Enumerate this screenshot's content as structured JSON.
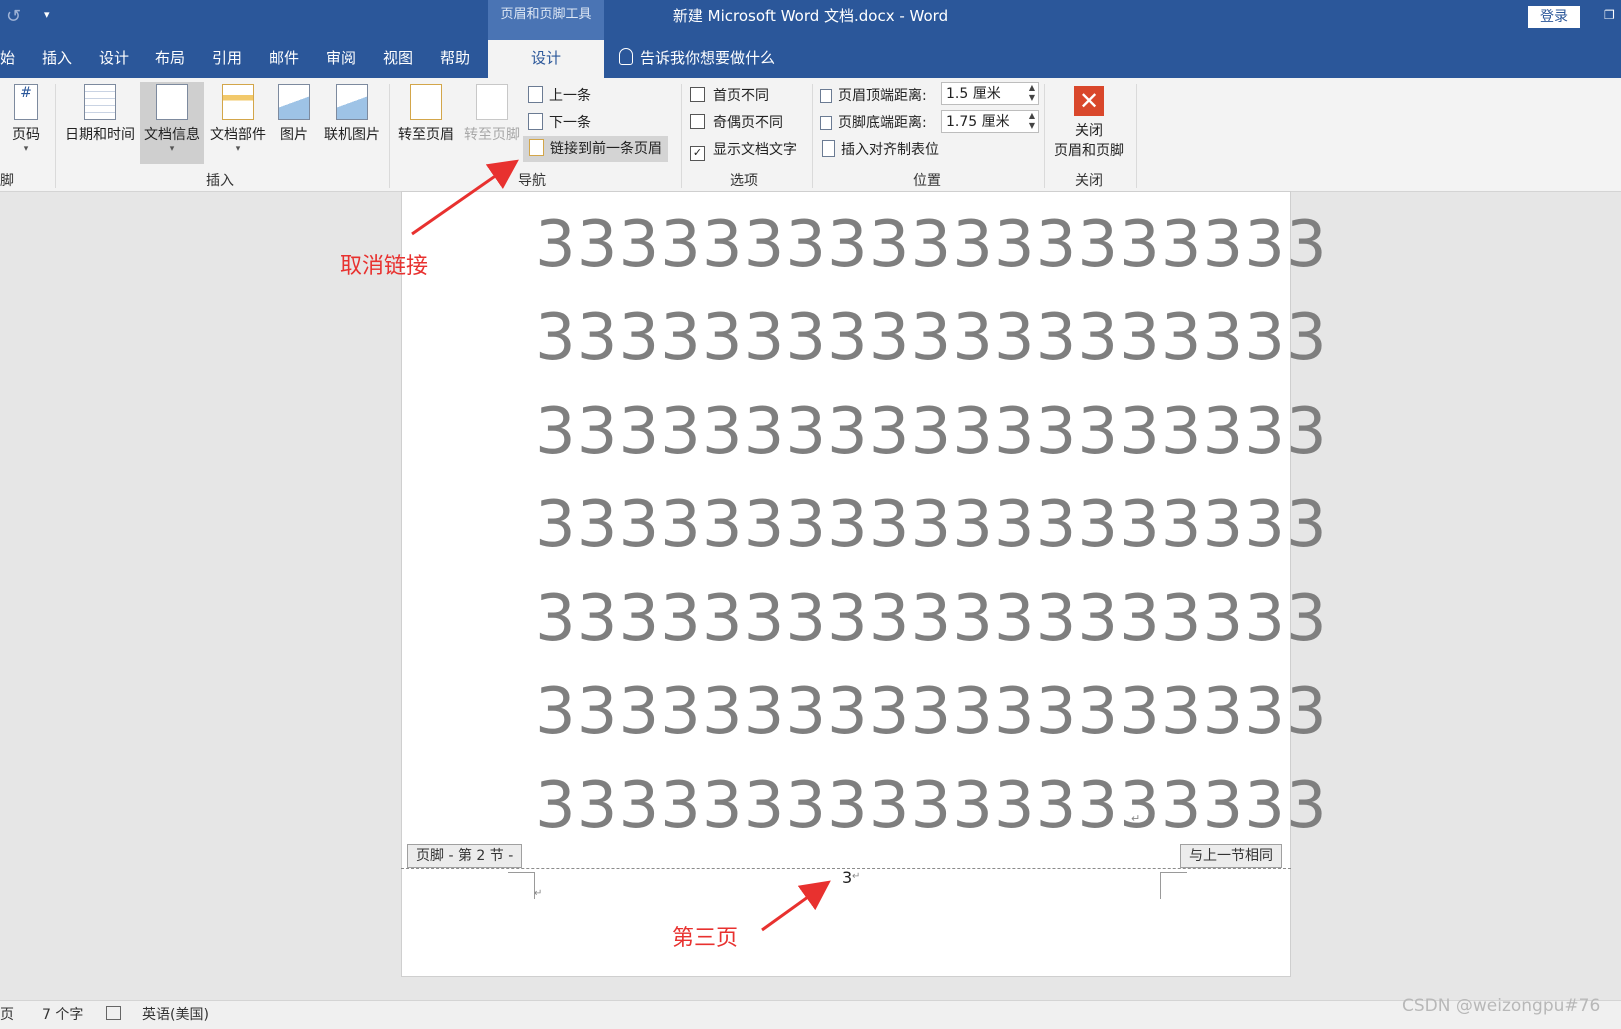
{
  "titlebar": {
    "title": "新建 Microsoft Word 文档.docx  -  Word",
    "context_tools": "页眉和页脚工具",
    "login": "登录"
  },
  "tabs": [
    "始",
    "插入",
    "设计",
    "布局",
    "引用",
    "邮件",
    "审阅",
    "视图",
    "帮助"
  ],
  "active_tab": "设计",
  "tell_me": "告诉我你想要做什么",
  "ribbon": {
    "page_number": "页码",
    "header_footer_group": "脚",
    "insert": {
      "date_time": "日期和时间",
      "doc_info": "文档信息",
      "doc_parts": "文档部件",
      "picture": "图片",
      "online_picture": "联机图片",
      "group": "插入"
    },
    "nav": {
      "goto_header": "转至页眉",
      "goto_footer": "转至页脚",
      "previous": "上一条",
      "next": "下一条",
      "link_previous": "链接到前一条页眉",
      "group": "导航"
    },
    "options": {
      "diff_first": "首页不同",
      "diff_odd_even": "奇偶页不同",
      "show_doc_text": "显示文档文字",
      "diff_first_checked": false,
      "diff_odd_even_checked": false,
      "show_doc_text_checked": true,
      "group": "选项"
    },
    "position": {
      "header_top_label": "页眉顶端距离:",
      "header_top_value": "1.5 厘米",
      "footer_bottom_label": "页脚底端距离:",
      "footer_bottom_value": "1.75 厘米",
      "insert_align_tab": "插入对齐制表位",
      "group": "位置"
    },
    "close": {
      "label_line1": "关闭",
      "label_line2": "页眉和页脚",
      "group": "关闭"
    }
  },
  "document": {
    "lines": [
      "3333333333333333333",
      "3333333333333333333",
      "3333333333333333333",
      "3333333333333333333",
      "3333333333333333333",
      "3333333333333333333",
      "3333333333333333333"
    ],
    "footer_tag": "页脚 - 第 2 节 -",
    "same_as_previous_tag": "与上一节相同",
    "footer_page_number": "3"
  },
  "annotations": {
    "unlink": "取消链接",
    "third_page": "第三页"
  },
  "statusbar": {
    "page": "页",
    "word_count": "7 个字",
    "language": "英语(美国)"
  },
  "watermark": "CSDN @weizongpu#76",
  "colors": {
    "title_blue": "#2b579a",
    "annotation_red": "#e8312f",
    "close_red": "#d9472b"
  }
}
